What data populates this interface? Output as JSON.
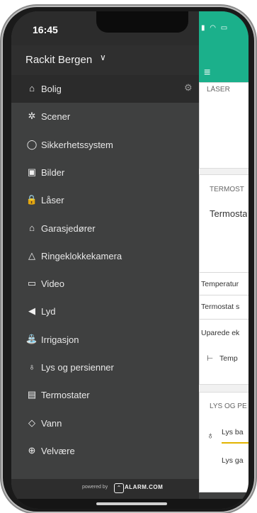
{
  "status": {
    "time": "16:45",
    "icons": "▮ ◠ ▭"
  },
  "drawer": {
    "account": "Rackit Bergen",
    "chevron": "∨",
    "items": [
      {
        "label": "Bolig",
        "icon": "home-icon",
        "glyph": "⌂"
      },
      {
        "label": "Scener",
        "icon": "scenes-icon",
        "glyph": "✲"
      },
      {
        "label": "Sikkerhetssystem",
        "icon": "shield-icon",
        "glyph": "◯"
      },
      {
        "label": "Bilder",
        "icon": "image-icon",
        "glyph": "▣"
      },
      {
        "label": "Låser",
        "icon": "lock-icon",
        "glyph": "🔒"
      },
      {
        "label": "Garasjedører",
        "icon": "garage-icon",
        "glyph": "⌂"
      },
      {
        "label": "Ringeklokkekamera",
        "icon": "bell-icon",
        "glyph": "△"
      },
      {
        "label": "Video",
        "icon": "video-icon",
        "glyph": "▭"
      },
      {
        "label": "Lyd",
        "icon": "speaker-icon",
        "glyph": "◀"
      },
      {
        "label": "Irrigasjon",
        "icon": "sprinkler-icon",
        "glyph": "⛲"
      },
      {
        "label": "Lys og persienner",
        "icon": "bulb-icon",
        "glyph": "♁"
      },
      {
        "label": "Termostater",
        "icon": "thermostat-icon",
        "glyph": "▤"
      },
      {
        "label": "Vann",
        "icon": "water-drop-icon",
        "glyph": "◇"
      },
      {
        "label": "Velvære",
        "icon": "wellness-icon",
        "glyph": "⊕"
      }
    ]
  },
  "footer": {
    "powered_by": "powered by",
    "brand": "ALARM.COM"
  },
  "content": {
    "menu": "≡",
    "locks_title": "LÅSER",
    "thermo_title": "TERMOST",
    "thermo_name": "Termosta",
    "temp_row": "Temperatur",
    "thermo_row": "Termostat s",
    "unpaired": "Uparede ek",
    "temp_item": "Temp",
    "lights_title": "LYS OG PE",
    "light1": "Lys ba",
    "light2": "Lys ga"
  }
}
